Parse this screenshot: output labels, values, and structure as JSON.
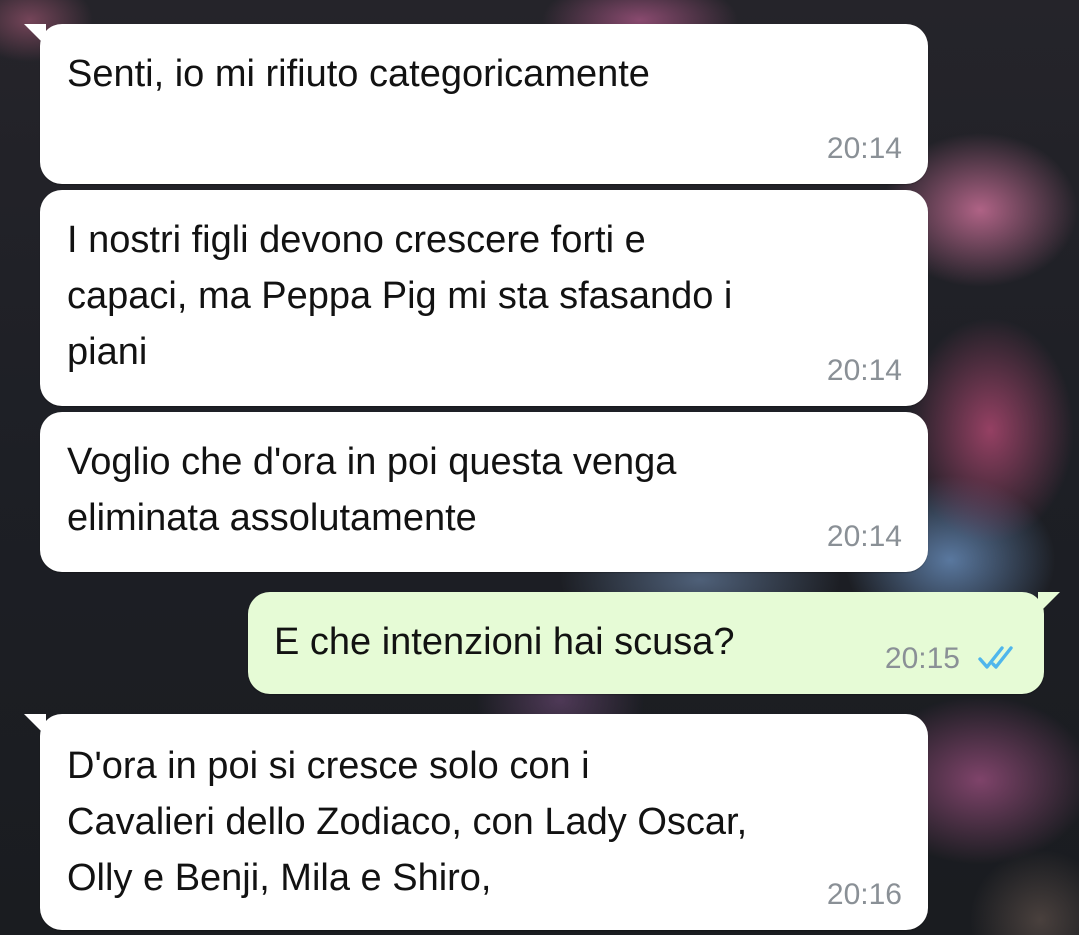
{
  "chat": {
    "messages": [
      {
        "direction": "incoming",
        "text": "Senti, io mi rifiuto categoricamente",
        "time": "20:14"
      },
      {
        "direction": "incoming",
        "text": "I nostri figli devono crescere forti e\ncapaci, ma Peppa Pig mi sta sfasando i\npiani",
        "time": "20:14"
      },
      {
        "direction": "incoming",
        "text": "Voglio che d'ora in poi questa venga\neliminata assolutamente",
        "time": "20:14"
      },
      {
        "direction": "outgoing",
        "text": "E che intenzioni hai scusa?",
        "time": "20:15",
        "status": "read",
        "status_icon": "double-check-icon",
        "status_color": "#4fb6ec"
      },
      {
        "direction": "incoming",
        "text": "D'ora in poi si cresce solo con i\nCavalieri dello Zodiaco, con Lady Oscar,\nOlly e Benji, Mila e Shiro,",
        "time": "20:16"
      }
    ]
  },
  "colors": {
    "incoming_bubble": "#ffffff",
    "outgoing_bubble": "#e6fbd6",
    "timestamp": "#8a9096",
    "read_ticks": "#4fb6ec"
  }
}
